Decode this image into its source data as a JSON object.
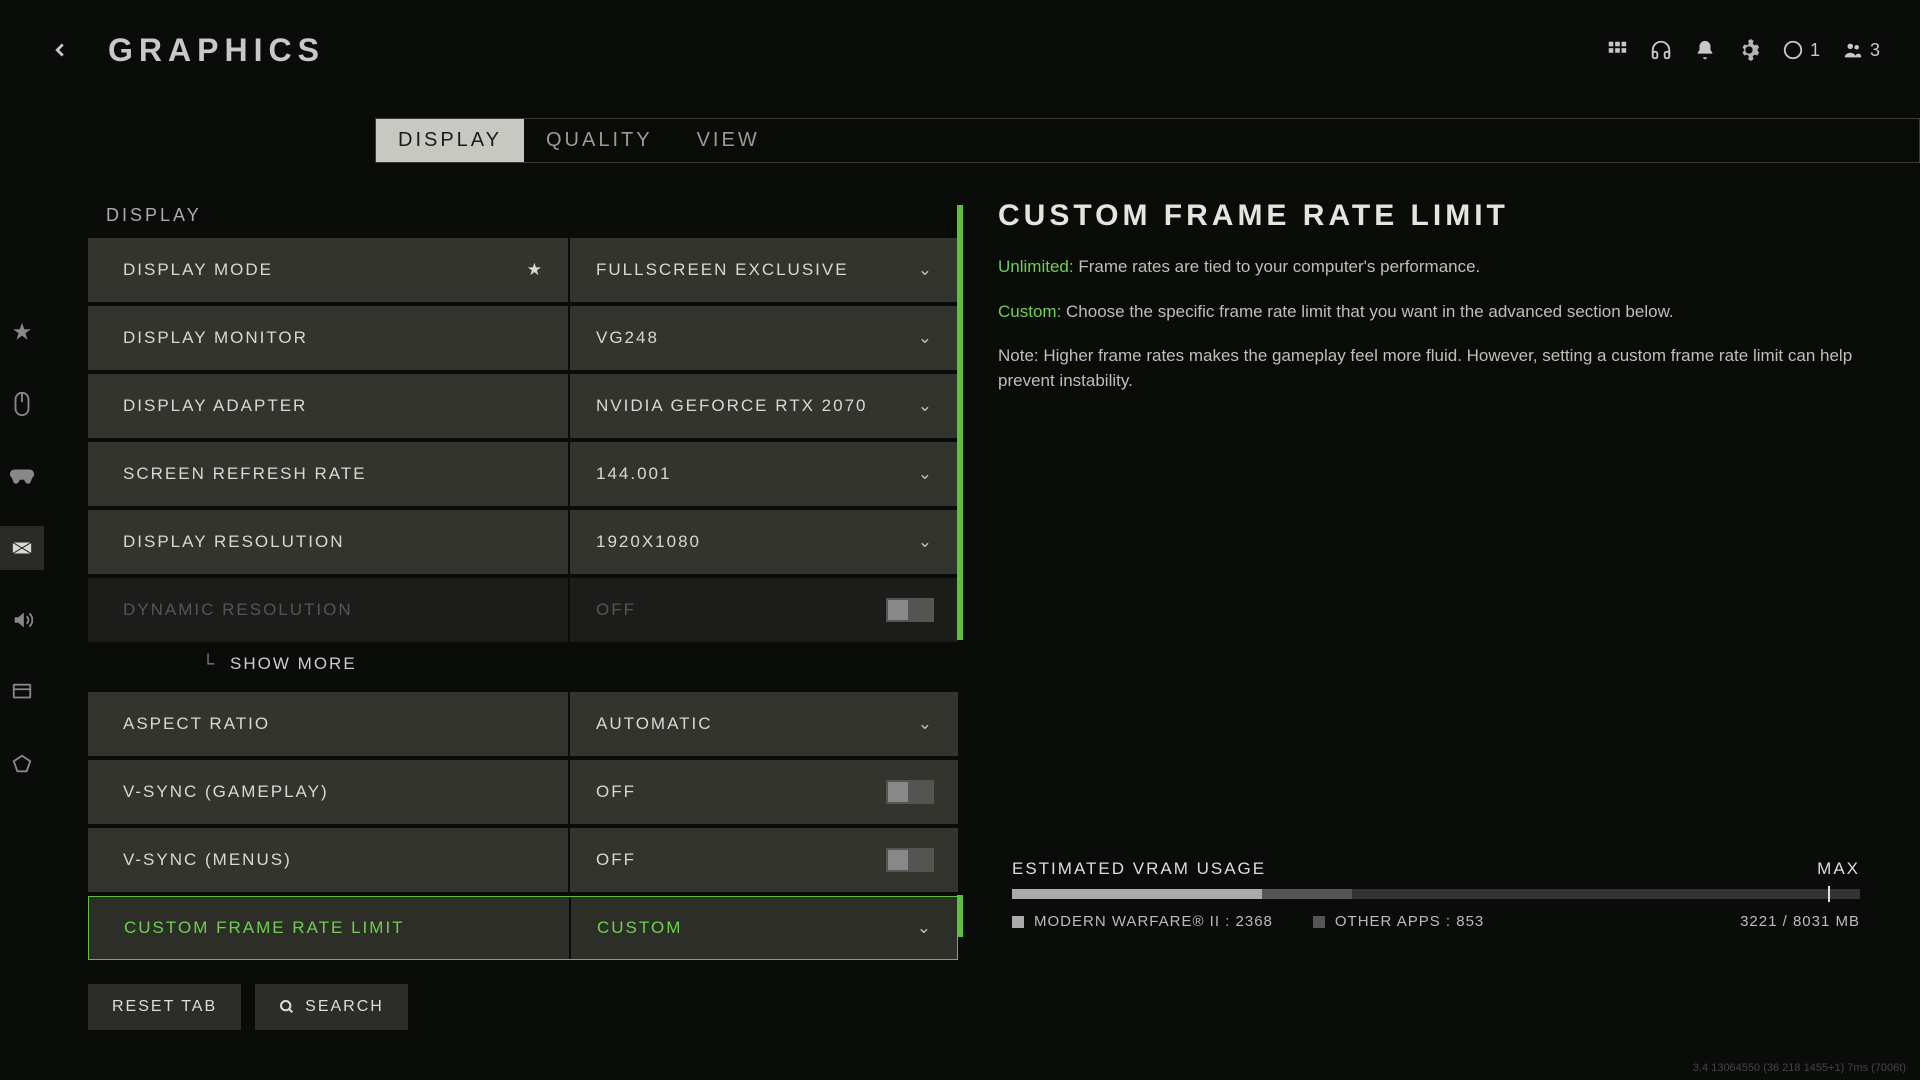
{
  "header": {
    "title": "GRAPHICS",
    "counts": {
      "party": "1",
      "friends": "3"
    }
  },
  "tabs": [
    "DISPLAY",
    "QUALITY",
    "VIEW"
  ],
  "section": "DISPLAY",
  "settings": [
    {
      "label": "DISPLAY MODE",
      "value": "FULLSCREEN EXCLUSIVE",
      "type": "dropdown",
      "star": true
    },
    {
      "label": "DISPLAY MONITOR",
      "value": "VG248",
      "type": "dropdown"
    },
    {
      "label": "DISPLAY ADAPTER",
      "value": "NVIDIA GEFORCE RTX 2070",
      "type": "dropdown"
    },
    {
      "label": "SCREEN REFRESH RATE",
      "value": "144.001",
      "type": "dropdown"
    },
    {
      "label": "DISPLAY RESOLUTION",
      "value": "1920X1080",
      "type": "dropdown"
    },
    {
      "label": "DYNAMIC RESOLUTION",
      "value": "OFF",
      "type": "toggle",
      "disabled": true
    },
    {
      "label": "ASPECT RATIO",
      "value": "AUTOMATIC",
      "type": "dropdown"
    },
    {
      "label": "V-SYNC (GAMEPLAY)",
      "value": "OFF",
      "type": "toggle"
    },
    {
      "label": "V-SYNC (MENUS)",
      "value": "OFF",
      "type": "toggle"
    },
    {
      "label": "CUSTOM FRAME RATE LIMIT",
      "value": "CUSTOM",
      "type": "dropdown",
      "selected": true
    }
  ],
  "show_more": "SHOW MORE",
  "detail": {
    "title": "CUSTOM FRAME RATE LIMIT",
    "p1a": "Unlimited:",
    "p1b": " Frame rates are tied to your computer's performance.",
    "p2a": "Custom:",
    "p2b": " Choose the specific frame rate limit that you want in the advanced section below.",
    "p3": "Note: Higher frame rates makes the gameplay feel more fluid. However, setting a custom frame rate limit can help prevent instability."
  },
  "vram": {
    "title": "ESTIMATED VRAM USAGE",
    "max_label": "MAX",
    "game_label": "MODERN WARFARE® II : 2368",
    "other_label": "OTHER APPS : 853",
    "total": "3221 / 8031 MB",
    "game_pct": "29.5%",
    "other_pct": "10.6%"
  },
  "footer": {
    "reset": "RESET TAB",
    "search": "SEARCH"
  },
  "build": "3.4 13064550 (36 218 1455+1) 7ms (7006t)"
}
